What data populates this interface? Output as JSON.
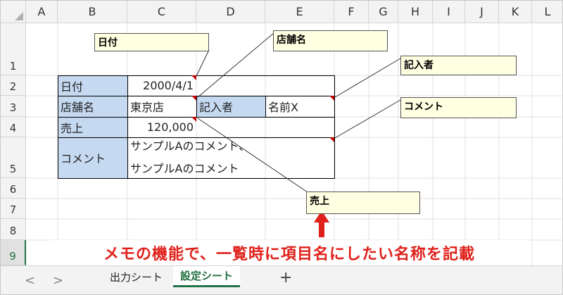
{
  "columns": [
    "A",
    "B",
    "C",
    "D",
    "E",
    "F",
    "G",
    "H",
    "I",
    "J",
    "K",
    "L"
  ],
  "rows": [
    "1",
    "2",
    "3",
    "4",
    "5",
    "6",
    "7",
    "8",
    "9"
  ],
  "cells": {
    "b2": "日付",
    "c2": "2000/4/1",
    "b3": "店舗名",
    "c3": "東京店",
    "d3": "記入者",
    "e3": "名前X",
    "b4": "売上",
    "c4": "120,000",
    "b5": "コメント",
    "c5_line1": "サンプルAのコメント、",
    "c5_line2": "サンプルAのコメント"
  },
  "memos": {
    "date": "日付",
    "store": "店舗名",
    "writer": "記入者",
    "comment": "コメント",
    "sales": "売上"
  },
  "annotation": "メモの機能で、一覧時に項目名にしたい名称を記載",
  "tabs": {
    "prev": "<",
    "next": ">",
    "sheet1": "出力シート",
    "sheet2": "設定シート",
    "add": "+"
  },
  "colors": {
    "label_fill": "#c5d9f1",
    "memo_fill": "#ffffe1",
    "annotation_red": "#e0201a",
    "comment_marker": "#c00000",
    "active_sheet": "#217346"
  }
}
